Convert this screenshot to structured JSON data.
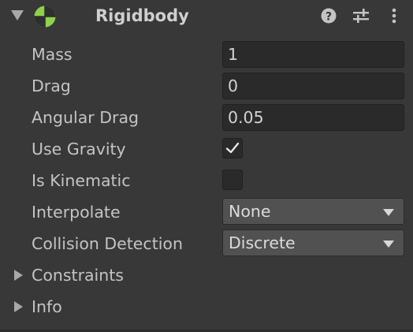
{
  "header": {
    "title": "Rigidbody",
    "icons": {
      "foldout": "triangle-down-icon",
      "component": "rigidbody-icon",
      "help": "help-icon",
      "presets": "presets-sliders-icon",
      "menu": "kebab-menu-icon"
    },
    "colors": {
      "component_icon_green": "#8fd14b",
      "component_icon_dark": "#2f2f2f"
    }
  },
  "fields": {
    "mass": {
      "label": "Mass",
      "value": "1"
    },
    "drag": {
      "label": "Drag",
      "value": "0"
    },
    "angular_drag": {
      "label": "Angular Drag",
      "value": "0.05"
    },
    "use_gravity": {
      "label": "Use Gravity",
      "checked": true
    },
    "is_kinematic": {
      "label": "Is Kinematic",
      "checked": false
    },
    "interpolate": {
      "label": "Interpolate",
      "selected": "None"
    },
    "collision_detection": {
      "label": "Collision Detection",
      "selected": "Discrete"
    }
  },
  "foldouts": {
    "constraints": {
      "label": "Constraints",
      "expanded": false
    },
    "info": {
      "label": "Info",
      "expanded": false
    }
  },
  "colors": {
    "panel_bg": "#383838",
    "field_bg": "#2a2a2a",
    "dropdown_bg": "#515151",
    "text": "#c4c4c4"
  }
}
